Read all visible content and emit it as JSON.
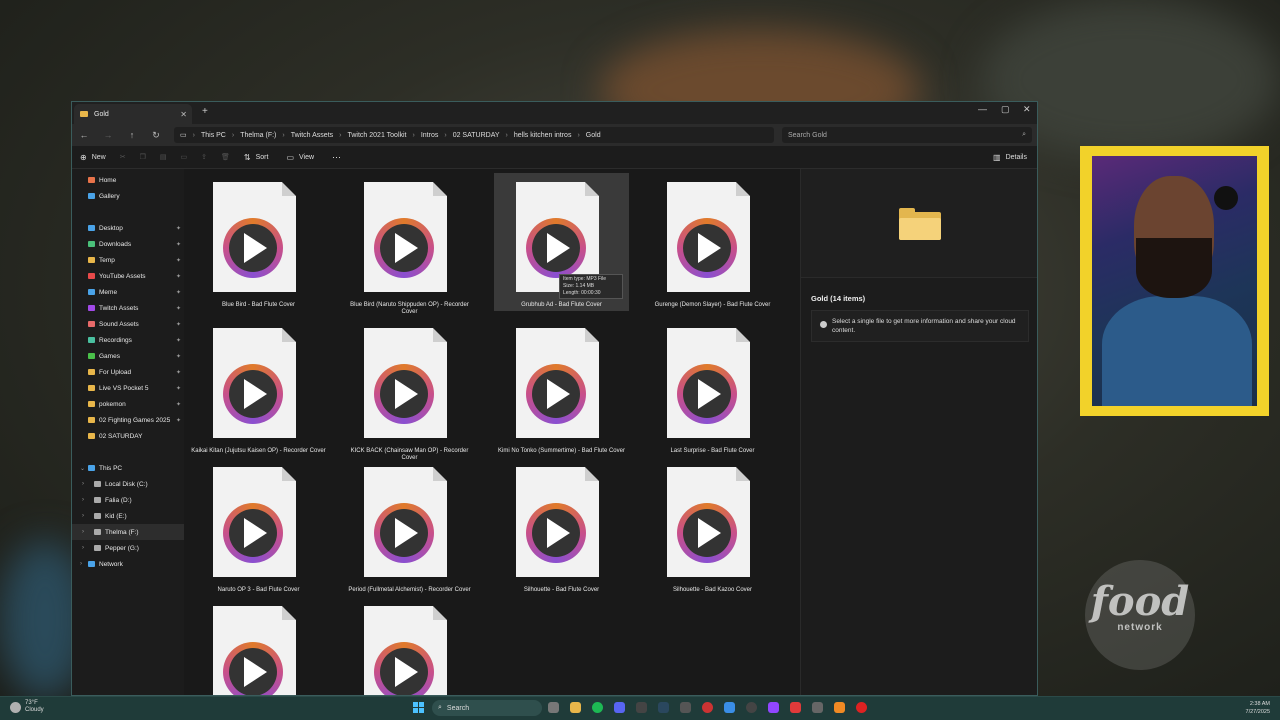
{
  "window": {
    "tab_title": "Gold",
    "breadcrumbs": [
      "This PC",
      "Thelma (F:)",
      "Twitch Assets",
      "Twitch 2021 Toolkit",
      "Intros",
      "02 SATURDAY",
      "hells kitchen intros",
      "Gold"
    ],
    "search_placeholder": "Search Gold",
    "commands": {
      "new": "New",
      "sort": "Sort",
      "view": "View",
      "details": "Details"
    }
  },
  "sidebar": {
    "top": [
      {
        "label": "Home",
        "color": "#e8734a"
      },
      {
        "label": "Gallery",
        "color": "#4aa3e8"
      }
    ],
    "pinned": [
      {
        "label": "Desktop",
        "color": "#4aa3e8"
      },
      {
        "label": "Downloads",
        "color": "#4ac07a"
      },
      {
        "label": "Temp",
        "color": "#e8b64a"
      },
      {
        "label": "YouTube Assets",
        "color": "#e84a4a"
      },
      {
        "label": "Meme",
        "color": "#4aa3e8"
      },
      {
        "label": "Twitch Assets",
        "color": "#a24ae8"
      },
      {
        "label": "Sound Assets",
        "color": "#e86a6a"
      },
      {
        "label": "Recordings",
        "color": "#4ac0a0"
      },
      {
        "label": "Games",
        "color": "#4ac04a"
      },
      {
        "label": "For Upload",
        "color": "#e8b64a"
      },
      {
        "label": "Live VS Pocket 5",
        "color": "#e8b64a"
      },
      {
        "label": "pokemon",
        "color": "#e8b64a"
      },
      {
        "label": "02 Fighting Games 2025",
        "color": "#e8b64a"
      },
      {
        "label": "02 SATURDAY",
        "color": "#e8b64a"
      }
    ],
    "this_pc": "This PC",
    "drives": [
      "Local Disk (C:)",
      "Falia (D:)",
      "Kid (E:)",
      "Thelma (F:)",
      "Pepper (G:)"
    ],
    "network": "Network"
  },
  "files": [
    "Blue Bird - Bad Flute Cover",
    "Blue Bird (Naruto Shippuden OP) - Recorder Cover",
    "Grubhub Ad - Bad Flute Cover",
    "Gurenge (Demon Slayer) - Bad Flute Cover",
    "Kaikai Kitan (Jujutsu Kaisen OP) - Recorder Cover",
    "KICK BACK (Chainsaw Man OP) - Recorder Cover",
    "Kimi No Tonko (Summertime) - Bad Flute Cover",
    "Last Surprise - Bad Flute Cover",
    "Naruto OP 3 - Bad Flute Cover",
    "Period (Fullmetal Alchemist) - Recorder Cover",
    "Silhouette - Bad Flute Cover",
    "Silhouette - Bad Kazoo Cover",
    "",
    ""
  ],
  "tooltip": {
    "type": "Item type: MP3 File",
    "size": "Size: 1.14 MB",
    "length": "Length: 00:00:30"
  },
  "details": {
    "title": "Gold (14 items)",
    "note": "Select a single file to get more information and share your cloud content."
  },
  "overlay": {
    "logo_line1": "food",
    "logo_line2": "network"
  },
  "taskbar": {
    "weather_temp": "73°F",
    "weather_desc": "Cloudy",
    "search": "Search",
    "time": "2:38 AM",
    "date": "7/27/2025"
  }
}
